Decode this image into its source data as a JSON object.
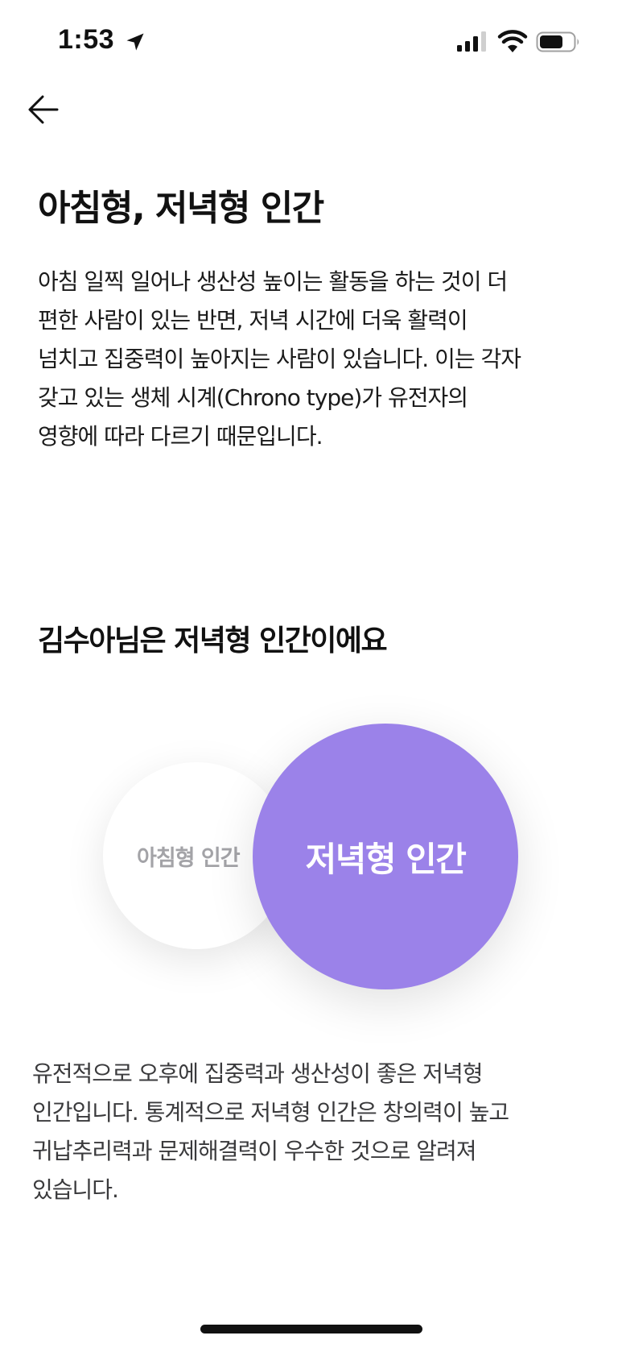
{
  "status_bar": {
    "time": "1:53"
  },
  "page": {
    "title": "아침형, 저녁형 인간",
    "intro_lines": [
      "아침 일찍 일어나 생산성 높이는 활동을 하는 것이 더",
      "편한 사람이 있는 반면, 저녁 시간에 더욱 활력이",
      "넘치고 집중력이 높아지는 사람이 있습니다. 이는 각자",
      "갖고 있는 생체 시계(Chrono type)가 유전자의",
      "영향에 따라 다르기 때문입니다."
    ],
    "result_heading": "김수아님은 저녁형 인간이에요",
    "result_lines": [
      "유전적으로 오후에 집중력과 생산성이 좋은 저녁형",
      "인간입니다. 통계적으로 저녁형 인간은 창의력이 높고",
      "귀납추리력과 문제해결력이 우수한 것으로 알려져",
      "있습니다."
    ]
  },
  "circles": {
    "morning_label": "아침형 인간",
    "evening_label": "저녁형 인간",
    "morning_color": "#ffffff",
    "evening_color": "#9b82e9"
  },
  "icons": {
    "status": [
      "location-arrow-icon",
      "cellular-signal-icon",
      "wifi-icon",
      "battery-icon"
    ],
    "nav": [
      "back-arrow-icon"
    ]
  }
}
